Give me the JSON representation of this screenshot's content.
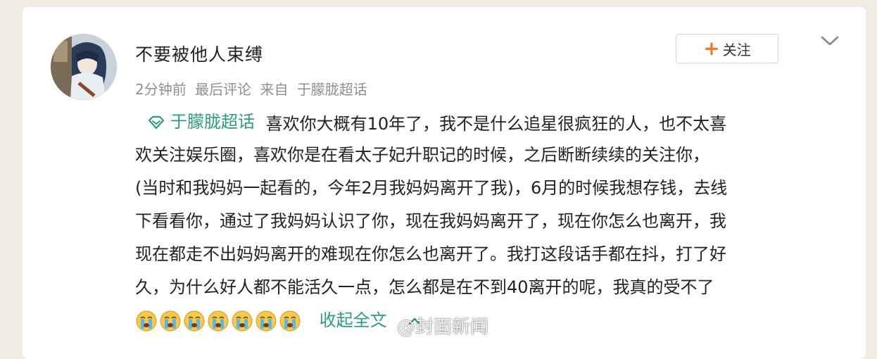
{
  "post": {
    "username": "不要被他人束缚",
    "meta": {
      "time": "2分钟前",
      "last_comment": "最后评论",
      "source_prefix": "来自",
      "source": "于朦胧超话"
    },
    "follow_label": "关注",
    "topic": "于朦胧超话",
    "lines": [
      "喜欢你大概有10年了，我不是什么追星很疯狂的人，也不太喜",
      "欢关注娱乐圈，喜欢你是在看太子妃升职记的时候，之后断断续续的关注你，",
      "(当时和我妈妈一起看的，今年2月我妈妈离开了我)，6月的时候我想存钱，去线",
      "下看看你，通过了我妈妈认识了你，现在我妈妈离开了，现在你怎么也离开，我",
      "现在都走不出妈妈离开的难现在你怎么也离开了。我打这段话手都在抖，打了好",
      "久，为什么好人都不能活久一点，怎么都是在不到40离开的呢，我真的受不了"
    ],
    "emoji_count": 7,
    "collapse_label": "收起全文"
  },
  "watermark": "@封面新闻",
  "colors": {
    "accent_green": "#2e9a7f",
    "follow_plus": "#f07a2b",
    "meta_gray": "#8f8f8f"
  },
  "icons": [
    "avatar",
    "plus-icon",
    "chevron-down-icon",
    "supertopic-diamond-icon",
    "crying-face-emoji",
    "weibo-logo-icon"
  ]
}
